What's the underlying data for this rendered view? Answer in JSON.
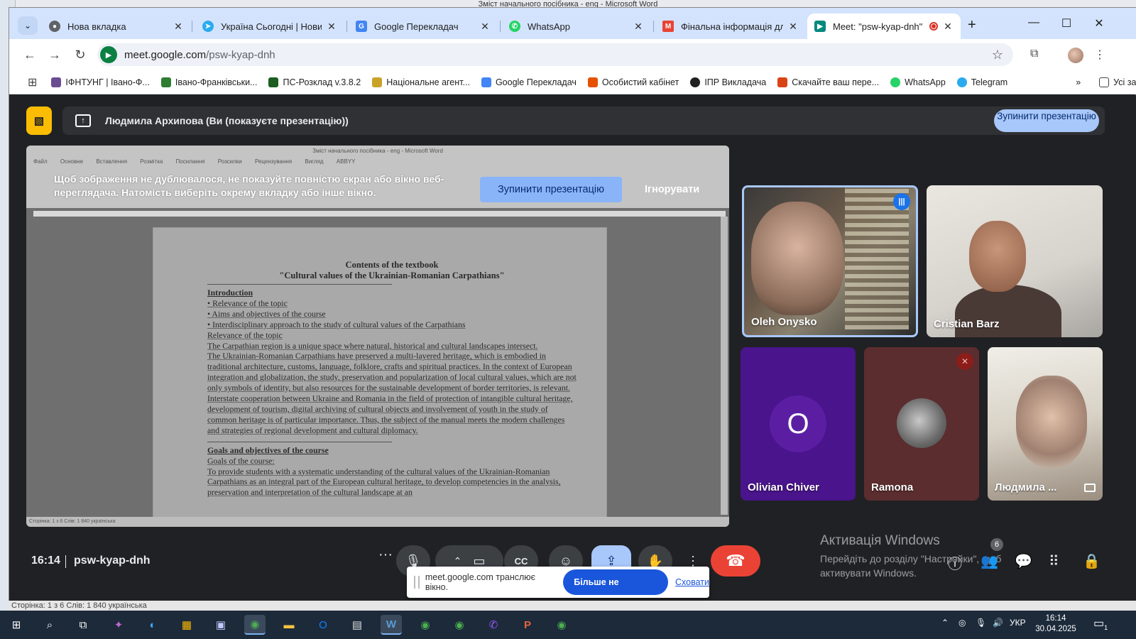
{
  "word": {
    "title": "Зміст начального посібника - eng - Microsoft Word",
    "status": "Сторінка: 1 з 6    Слів: 1 840    українська"
  },
  "tabs": [
    {
      "label": "Нова вкладка",
      "icon": "chrome-icon",
      "color": "#5f6368"
    },
    {
      "label": "Україна Сьогодні | Новини",
      "icon": "telegram-icon",
      "color": "#2aabee"
    },
    {
      "label": "Google Перекладач",
      "icon": "translate-icon",
      "color": "#4285f4"
    },
    {
      "label": "WhatsApp",
      "icon": "whatsapp-icon",
      "color": "#25d366"
    },
    {
      "label": "Фінальна інформація для с",
      "icon": "gmail-icon",
      "color": "#ea4335"
    },
    {
      "label": "Meet: \"psw-kyap-dnh\"",
      "icon": "meet-icon",
      "color": "#00897b",
      "active": true
    }
  ],
  "toolbar": {
    "url_host": "meet.google.com",
    "url_path": "/psw-kyap-dnh"
  },
  "bookmarks": [
    {
      "label": "ІФНТУНГ | Івано-Ф...",
      "color": "#6a4c93"
    },
    {
      "label": "Івано-Франківськи...",
      "color": "#2e7d32"
    },
    {
      "label": "ПС-Розклад v.3.8.2",
      "color": "#1b5e20"
    },
    {
      "label": "Національне агент...",
      "color": "#c9a227"
    },
    {
      "label": "Google Перекладач",
      "color": "#4285f4"
    },
    {
      "label": "Особистий кабінет",
      "color": "#e65100"
    },
    {
      "label": "ІПР Викладача",
      "color": "#212121"
    },
    {
      "label": "Скачайте ваш пере...",
      "color": "#d84315"
    },
    {
      "label": "WhatsApp",
      "color": "#25d366"
    },
    {
      "label": "Telegram",
      "color": "#2aabee"
    }
  ],
  "bookmarks_more": "»",
  "bookmarks_all": "Усі закладки",
  "meet": {
    "presenter_text": "Людмила Архипова (Ви (показуєте презентацію))",
    "stop_presenting": "Зупинити презентацію",
    "warning": "Щоб зображення не дублювалося, не показуйте повністю екран або вікно веб-переглядача. Натомість виберіть окрему вкладку або інше вікно.",
    "warning_stop": "Зупинити презентацію",
    "warning_ignore": "Ігнорувати",
    "time": "16:14",
    "code": "psw-kyap-dnh",
    "people_count": "6",
    "participants": [
      {
        "name": "Oleh Onysko"
      },
      {
        "name": "Cristian Barz"
      },
      {
        "name": "Olivian Chiver",
        "initial": "O"
      },
      {
        "name": "Ramona"
      },
      {
        "name": "Людмила ..."
      }
    ]
  },
  "document": {
    "title1": "Contents of the textbook",
    "title2": "\"Cultural values of the Ukrainian-Romanian Carpathians\"",
    "lines": [
      {
        "text": "Introduction",
        "bold": true
      },
      {
        "text": "• Relevance of the topic"
      },
      {
        "text": "• Aims and objectives of the course"
      },
      {
        "text": "• Interdisciplinary approach to the study of cultural values of the Carpathians"
      },
      {
        "text": "Relevance of the topic"
      },
      {
        "text": "The Carpathian region is a unique space where natural, historical and cultural landscapes intersect."
      },
      {
        "text": "The Ukrainian-Romanian Carpathians have preserved a multi-layered heritage, which is embodied in traditional architecture, customs, language, folklore, crafts and spiritual practices. In the context of European integration and globalization, the study, preservation and popularization of local cultural values, which are not only symbols of identity, but also resources for the sustainable development of border territories, is relevant."
      },
      {
        "text": "Interstate cooperation between Ukraine and Romania in the field of protection of intangible cultural heritage, development of tourism, digital archiving of cultural objects and involvement of youth in the study of common heritage is of particular importance. Thus, the subject of the manual meets the modern challenges and strategies of regional development and cultural diplomacy."
      },
      {
        "text": "Goals and objectives of the course",
        "bold": true,
        "gap": true
      },
      {
        "text": "Goals of the course:"
      },
      {
        "text": "To provide students with a systematic understanding of the cultural values of the Ukrainian-Romanian Carpathians as an integral part of the European cultural heritage, to develop competencies in the analysis, preservation and interpretation of the cultural landscape at an"
      }
    ]
  },
  "activation": {
    "title": "Активація Windows",
    "text": "Перейдіть до розділу \"Настройки\", щоб активувати Windows."
  },
  "sharebar": {
    "text": "meet.google.com транслює вікно.",
    "stop": "Більше не ділитися",
    "hide": "Сховати"
  },
  "taskbar": {
    "lang": "УКР",
    "time": "16:14",
    "date": "30.04.2025",
    "notif": "1"
  }
}
